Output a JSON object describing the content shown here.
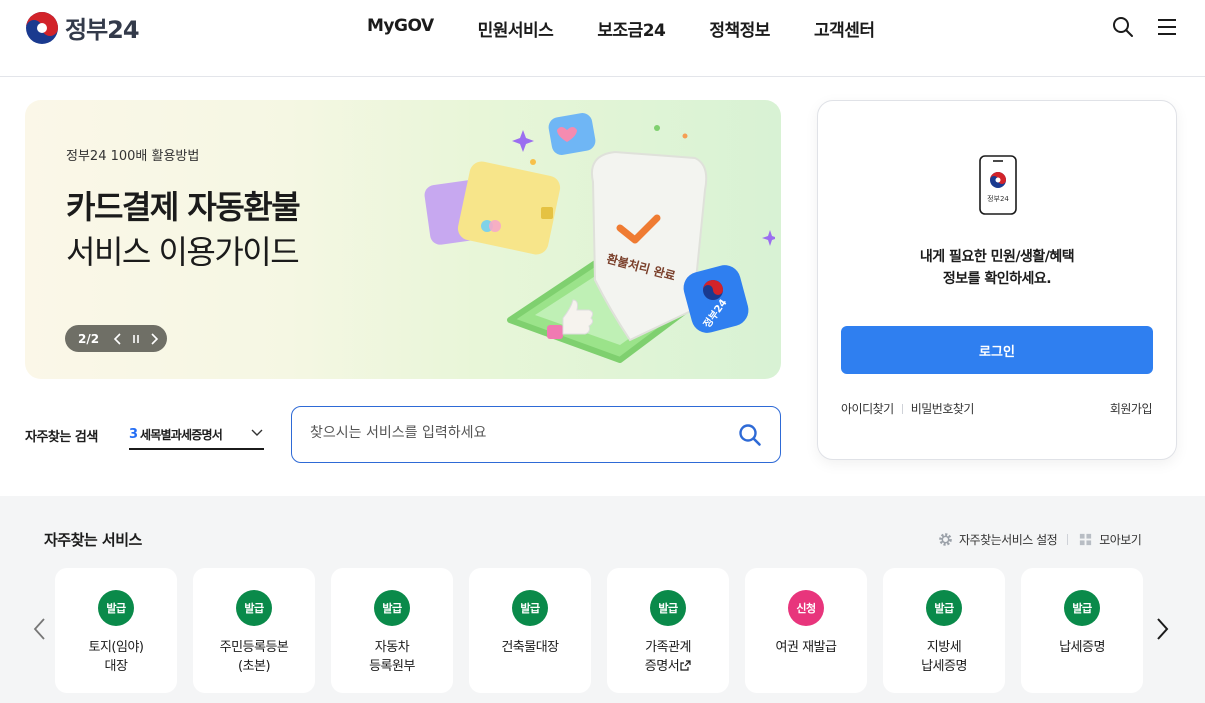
{
  "header": {
    "logo_text": "정부24",
    "nav": [
      "MyGOV",
      "민원서비스",
      "보조금24",
      "정책정보",
      "고객센터"
    ]
  },
  "banner": {
    "subtitle": "정부24 100배 활용방법",
    "title_line1": "카드결제 자동환불",
    "title_line2": "서비스 이용가이드",
    "page": "2/2",
    "art_receipt_text": "환불처리 완료",
    "art_badge_text": "정부24"
  },
  "search": {
    "label": "자주찾는 검색",
    "selected_rank": "3",
    "selected_text": "세목별과세증명서",
    "placeholder": "찾으시는 서비스를 입력하세요"
  },
  "login": {
    "phone_label": "정부24",
    "message_line1": "내게 필요한 민원/생활/혜택",
    "message_line2": "정보를 확인하세요.",
    "button": "로그인",
    "find_id": "아이디찾기",
    "find_pw": "비밀번호찾기",
    "signup": "회원가입"
  },
  "services": {
    "title": "자주찾는 서비스",
    "settings": "자주찾는서비스 설정",
    "view_all": "모아보기",
    "items": [
      {
        "badge": "발급",
        "name": "토지(임야)\n대장",
        "type": "issue"
      },
      {
        "badge": "발급",
        "name": "주민등록등본\n(초본)",
        "type": "issue"
      },
      {
        "badge": "발급",
        "name": "자동차\n등록원부",
        "type": "issue"
      },
      {
        "badge": "발급",
        "name": "건축물대장",
        "type": "issue"
      },
      {
        "badge": "발급",
        "name": "가족관계\n증명서",
        "type": "issue",
        "external": true
      },
      {
        "badge": "신청",
        "name": "여권 재발급",
        "type": "apply"
      },
      {
        "badge": "발급",
        "name": "지방세\n납세증명",
        "type": "issue"
      },
      {
        "badge": "발급",
        "name": "납세증명",
        "type": "issue"
      }
    ]
  },
  "colors": {
    "primary": "#2f7ff0",
    "issue_badge": "#0a8a4a",
    "apply_badge": "#e8357c",
    "search_border": "#2e6ad6"
  }
}
